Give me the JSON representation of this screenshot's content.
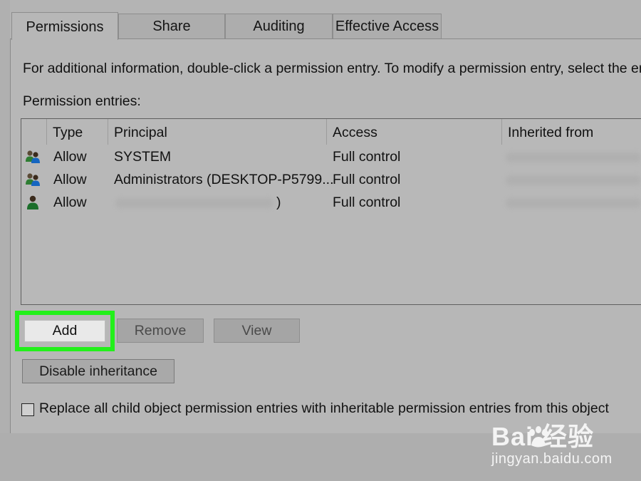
{
  "tabs": [
    {
      "label": "Permissions",
      "active": true
    },
    {
      "label": "Share",
      "active": false
    },
    {
      "label": "Auditing",
      "active": false
    },
    {
      "label": "Effective Access",
      "active": false
    }
  ],
  "info_text": "For additional information, double-click a permission entry. To modify a permission entry, select the ent",
  "entries_label": "Permission entries:",
  "columns": {
    "type": "Type",
    "principal": "Principal",
    "access": "Access",
    "inherited": "Inherited from"
  },
  "entries": [
    {
      "icon": "group-users-icon",
      "type": "Allow",
      "principal": "SYSTEM",
      "access": "Full control",
      "inherited": ""
    },
    {
      "icon": "group-users-icon",
      "type": "Allow",
      "principal": "Administrators (DESKTOP-P5799...",
      "access": "Full control",
      "inherited": ""
    },
    {
      "icon": "user-icon",
      "type": "Allow",
      "principal": ")",
      "access": "Full control",
      "inherited": ""
    }
  ],
  "buttons": {
    "add": "Add",
    "remove": "Remove",
    "view": "View",
    "disable_inheritance": "Disable inheritance"
  },
  "replace_checkbox": {
    "label": "Replace all child object permission entries with inheritable permission entries from this object",
    "checked": false
  },
  "watermark": {
    "brand": "Bai  经验",
    "url": "jingyan.baidu.com"
  },
  "colors": {
    "highlight": "#22f01a",
    "background": "#b7b7b7"
  }
}
